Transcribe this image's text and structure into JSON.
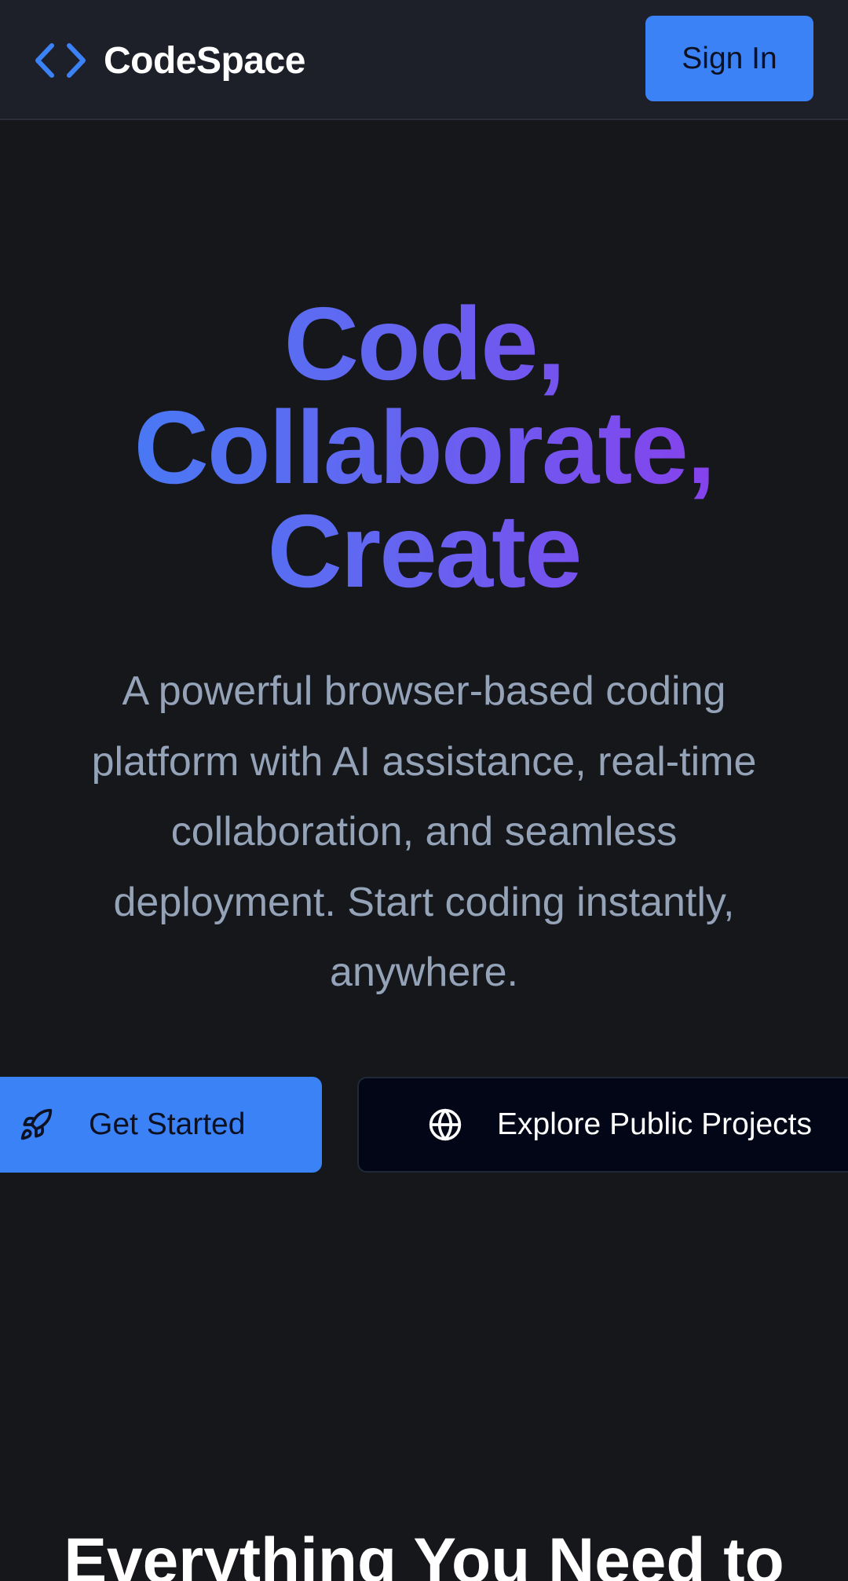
{
  "header": {
    "brand": "CodeSpace",
    "logo_icon": "code-brackets-icon",
    "signin_label": "Sign In"
  },
  "hero": {
    "title_lines": [
      "Code,",
      "Collaborate,",
      "Create"
    ],
    "subtitle_lines": [
      "A powerful browser-based coding",
      "platform with AI assistance, real-time",
      "collaboration, and seamless",
      "deployment. Start coding instantly,",
      "anywhere."
    ]
  },
  "cta": {
    "primary": {
      "label": "Get Started",
      "icon": "rocket-icon"
    },
    "secondary": {
      "label": "Explore Public Projects",
      "icon": "globe-icon"
    }
  },
  "features": {
    "heading": "Everything You Need to"
  },
  "colors": {
    "background": "#16171b",
    "header_bg": "#1e2029",
    "accent": "#3b82f6",
    "gradient_start": "#3b82f6",
    "gradient_end": "#9333ea",
    "muted_text": "#94a3b8"
  }
}
